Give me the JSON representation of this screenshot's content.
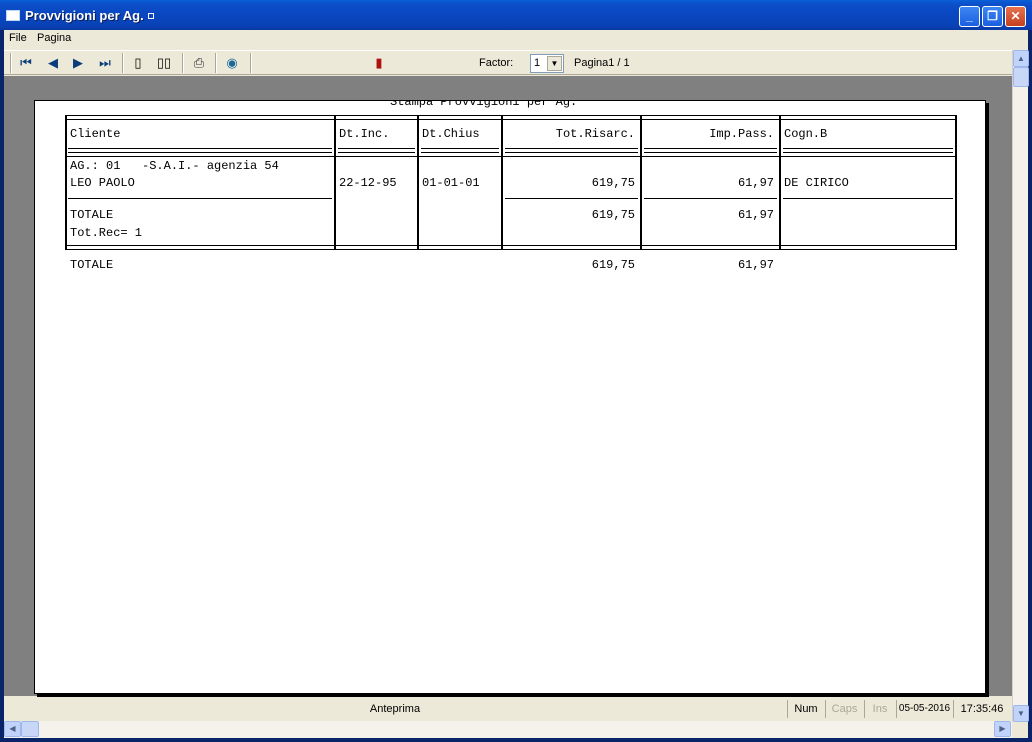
{
  "window": {
    "title": "Provvigioni per Ag."
  },
  "menu": {
    "file": "File",
    "pagina": "Pagina"
  },
  "toolbar": {
    "factor_label": "Factor:",
    "factor_value": "1",
    "page_label": "Pagina1 / 1",
    "icons": [
      "first-page-icon",
      "prev-page-icon",
      "next-page-icon",
      "last-page-icon",
      "single-page-icon",
      "two-page-icon",
      "print-icon",
      "export-icon",
      "exit-icon"
    ]
  },
  "report": {
    "title": "Stampa Provvigioni per Ag.",
    "headers": {
      "cliente": "Cliente",
      "dt_inc": "Dt.Inc.",
      "dt_chius": "Dt.Chius",
      "tot_risarc": "Tot.Risarc.",
      "imp_pass": "Imp.Pass.",
      "cogn_b": "Cogn.B"
    },
    "group_line": "AG.: 01   -S.A.I.- agenzia 54",
    "row": {
      "cliente": "LEO PAOLO",
      "dt_inc": "22-12-95",
      "dt_chius": "01-01-01",
      "tot_risarc": "619,75",
      "imp_pass": "61,97",
      "cogn_b": "DE CIRICO"
    },
    "subtotal": {
      "label": "TOTALE",
      "tot_risarc": "619,75",
      "imp_pass": "61,97",
      "rec": "Tot.Rec= 1"
    },
    "grand_total": {
      "label": "TOTALE",
      "tot_risarc": "619,75",
      "imp_pass": "61,97"
    }
  },
  "status": {
    "mode": "Anteprima",
    "num": "Num",
    "caps": "Caps",
    "ins": "Ins",
    "date": "05-05-2016",
    "time": "17:35:46"
  }
}
